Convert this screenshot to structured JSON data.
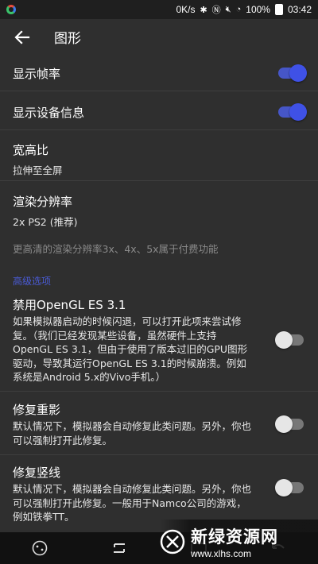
{
  "statusbar": {
    "speed": "0K/s",
    "battery": "100%",
    "time": "03:42"
  },
  "toolbar": {
    "title": "图形"
  },
  "settings": {
    "show_fps": {
      "label": "显示帧率",
      "enabled": true
    },
    "show_device_info": {
      "label": "显示设备信息",
      "enabled": true
    },
    "aspect_ratio": {
      "label": "宽高比",
      "value": "拉伸至全屏"
    },
    "render_resolution": {
      "label": "渲染分辨率",
      "value": "2x PS2 (推荐)"
    },
    "premium_note": "更高清的渲染分辨率3x、4x、5x属于付费功能",
    "advanced_header": "高级选项",
    "disable_gles31": {
      "label": "禁用OpenGL ES 3.1",
      "description": "如果模拟器启动的时候闪退，可以打开此项来尝试修复。（我们已经发现某些设备，虽然硬件上支持OpenGL ES 3.1，但由于使用了版本过旧的GPU图形驱动，导致其运行OpenGL ES 3.1的时候崩溃。例如系统是Android 5.x的Vivo手机。）",
      "enabled": false
    },
    "fix_ghosting": {
      "label": "修复重影",
      "description": "默认情况下，模拟器会自动修复此类问题。另外，你也可以强制打开此修复。",
      "enabled": false
    },
    "fix_vertical_lines": {
      "label": "修复竖线",
      "description": "默认情况下，模拟器会自动修复此类问题。另外，你也可以强制打开此修复。一般用于Namco公司的游戏，例如铁拳TT。",
      "enabled": false
    }
  },
  "watermark": {
    "name": "新绿资源网",
    "url": "www.xlhs.com"
  },
  "colors": {
    "accent": "#3f51e6",
    "section": "#4a5bd6",
    "background": "#2f2f2f"
  }
}
